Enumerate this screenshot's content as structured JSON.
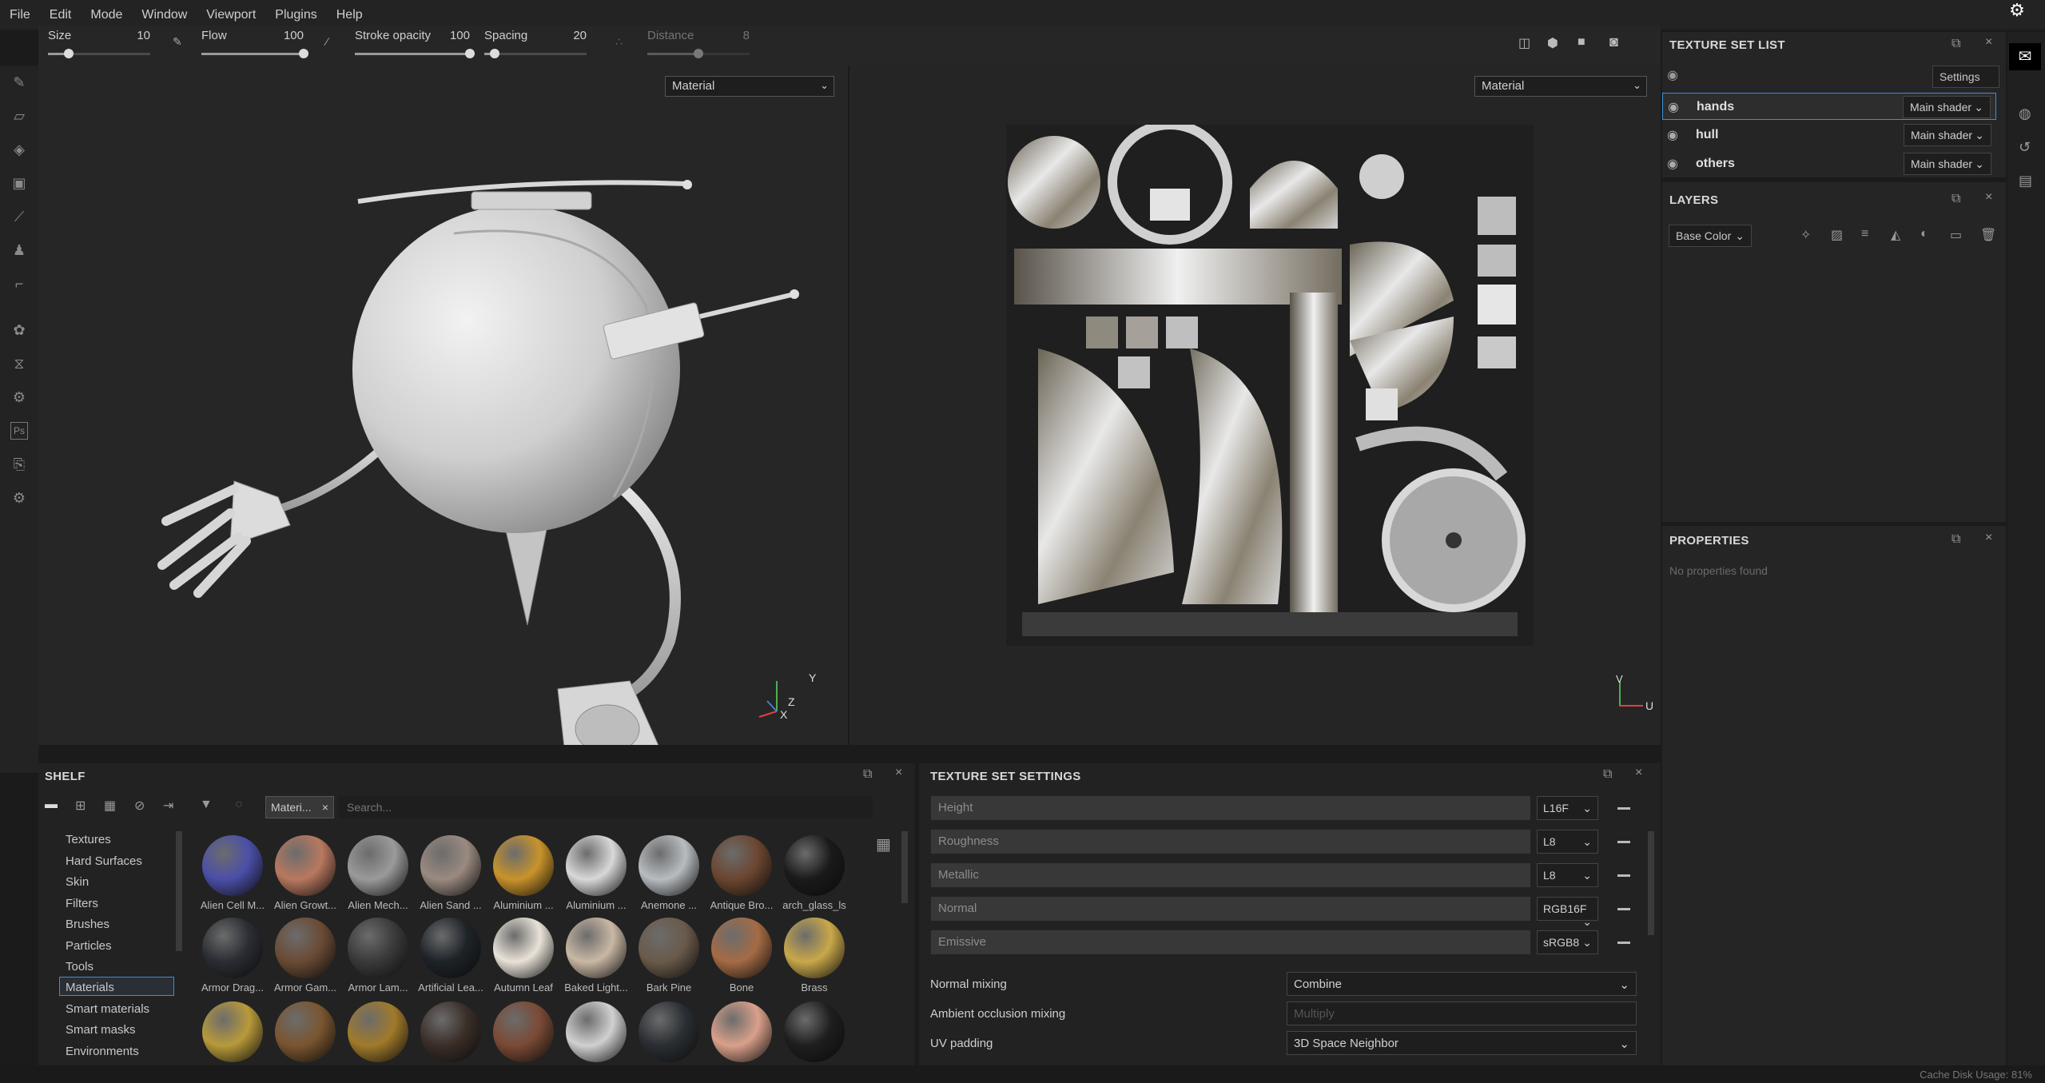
{
  "menu": [
    "File",
    "Edit",
    "Mode",
    "Window",
    "Viewport",
    "Plugins",
    "Help"
  ],
  "tool_options": {
    "size_label": "Size",
    "size_value": "10",
    "size_level": 0.2,
    "flow_label": "Flow",
    "flow_value": "100",
    "flow_level": 1.0,
    "stroke_opacity_label": "Stroke opacity",
    "stroke_opacity_value": "100",
    "stroke_opacity_level": 1.0,
    "spacing_label": "Spacing",
    "spacing_value": "20",
    "spacing_level": 0.1,
    "distance_label": "Distance",
    "distance_value": "8",
    "distance_level": 0.5
  },
  "viewport3d": {
    "dropdown": "Material",
    "axis_y": "Y",
    "axis_z": "Z",
    "axis_x": "X"
  },
  "viewport2d": {
    "dropdown": "Material",
    "axis_v": "V",
    "axis_u": "U"
  },
  "texture_set_list": {
    "title": "TEXTURE SET LIST",
    "settings_label": "Settings",
    "rows": [
      {
        "name": "hands",
        "shader": "Main shader"
      },
      {
        "name": "hull",
        "shader": "Main shader"
      },
      {
        "name": "others",
        "shader": "Main shader"
      }
    ]
  },
  "layers": {
    "title": "LAYERS",
    "channel": "Base Color"
  },
  "properties": {
    "title": "PROPERTIES",
    "empty_text": "No properties found"
  },
  "shelf": {
    "title": "SHELF",
    "filter_tag": "Materi...",
    "search_placeholder": "Search...",
    "categories": [
      "Textures",
      "Hard Surfaces",
      "Skin",
      "Filters",
      "Brushes",
      "Particles",
      "Tools",
      "Materials",
      "Smart materials",
      "Smart masks",
      "Environments"
    ],
    "selected_category": "Materials",
    "materials_row1": [
      "Alien Cell M...",
      "Alien Growt...",
      "Alien Mech...",
      "Alien Sand ...",
      "Aluminium ...",
      "Aluminium ...",
      "Anemone ...",
      "Antique Bro...",
      "arch_glass_ls"
    ],
    "materials_row2": [
      "Armor Drag...",
      "Armor Gam...",
      "Armor Lam...",
      "Artificial Lea...",
      "Autumn Leaf",
      "Baked Light...",
      "Bark Pine",
      "Bone",
      "Brass"
    ]
  },
  "texture_set_settings": {
    "title": "TEXTURE SET SETTINGS",
    "channels": [
      {
        "name": "Height",
        "format": "L16F"
      },
      {
        "name": "Roughness",
        "format": "L8"
      },
      {
        "name": "Metallic",
        "format": "L8"
      },
      {
        "name": "Normal",
        "format": "RGB16F"
      },
      {
        "name": "Emissive",
        "format": "sRGB8"
      }
    ],
    "normal_mixing_label": "Normal mixing",
    "normal_mixing_value": "Combine",
    "ao_mixing_label": "Ambient occlusion mixing",
    "ao_mixing_value": "Multiply",
    "uv_padding_label": "UV padding",
    "uv_padding_value": "3D Space Neighbor"
  },
  "status": {
    "cache_disk_usage": "Cache Disk Usage:  81%"
  }
}
